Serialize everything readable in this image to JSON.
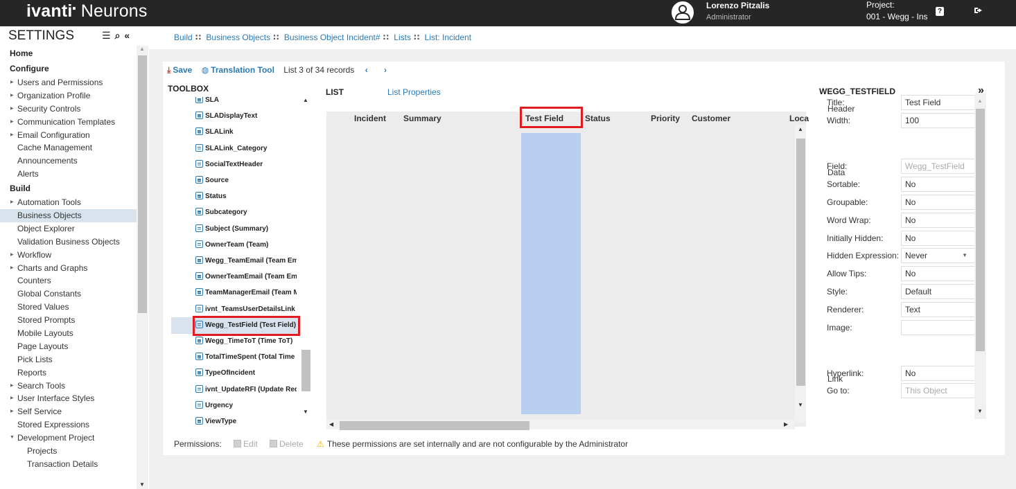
{
  "app": {
    "brand_bold": "ivanti",
    "brand_light": "Neurons"
  },
  "user": {
    "name": "Lorenzo Pitzalis",
    "role": "Administrator"
  },
  "project": {
    "label": "Project:",
    "value": "001 - Wegg - Ins"
  },
  "sidebar": {
    "title": "SETTINGS",
    "items": [
      {
        "label": "Home",
        "type": "section"
      },
      {
        "label": "Configure",
        "type": "section"
      },
      {
        "label": "Users and Permissions",
        "type": "arrow"
      },
      {
        "label": "Organization Profile",
        "type": "arrow"
      },
      {
        "label": "Security Controls",
        "type": "arrow"
      },
      {
        "label": "Communication Templates",
        "type": "arrow"
      },
      {
        "label": "Email Configuration",
        "type": "arrow"
      },
      {
        "label": "Cache Management",
        "type": "plain"
      },
      {
        "label": "Announcements",
        "type": "plain"
      },
      {
        "label": "Alerts",
        "type": "plain"
      },
      {
        "label": "Build",
        "type": "section"
      },
      {
        "label": "Automation Tools",
        "type": "arrow"
      },
      {
        "label": "Business Objects",
        "type": "selected"
      },
      {
        "label": "Object Explorer",
        "type": "plain"
      },
      {
        "label": "Validation Business Objects",
        "type": "plain"
      },
      {
        "label": "Workflow",
        "type": "arrow"
      },
      {
        "label": "Charts and Graphs",
        "type": "arrow"
      },
      {
        "label": "Counters",
        "type": "plain"
      },
      {
        "label": "Global Constants",
        "type": "plain"
      },
      {
        "label": "Stored Values",
        "type": "plain"
      },
      {
        "label": "Stored Prompts",
        "type": "plain"
      },
      {
        "label": "Mobile Layouts",
        "type": "plain"
      },
      {
        "label": "Page Layouts",
        "type": "plain"
      },
      {
        "label": "Pick Lists",
        "type": "plain"
      },
      {
        "label": "Reports",
        "type": "plain"
      },
      {
        "label": "Search Tools",
        "type": "arrow"
      },
      {
        "label": "User Interface Styles",
        "type": "arrow"
      },
      {
        "label": "Self Service",
        "type": "arrow"
      },
      {
        "label": "Stored Expressions",
        "type": "plain"
      },
      {
        "label": "Development Project",
        "type": "arrow-down"
      },
      {
        "label": "Projects",
        "type": "sub"
      },
      {
        "label": "Transaction Details",
        "type": "sub"
      }
    ]
  },
  "breadcrumb": [
    "Build",
    "Business Objects",
    "Business Object Incident#",
    "Lists",
    "List: Incident"
  ],
  "toolbar": {
    "save_label": "Save",
    "translation_label": "Translation Tool",
    "records_info": "List 3 of 34 records",
    "prev": "‹",
    "next": "›"
  },
  "toolbox": {
    "title": "TOOLBOX",
    "items": [
      "SLA",
      "SLADisplayText",
      "SLALink",
      "SLALink_Category",
      "SocialTextHeader",
      "Source",
      "Status",
      "Subcategory",
      "Subject (Summary)",
      "OwnerTeam (Team)",
      "Wegg_TeamEmail (Team Email)",
      "OwnerTeamEmail (Team Email)",
      "TeamManagerEmail (Team Manager Email)",
      "ivnt_TeamsUserDetailsLink",
      "Wegg_TestField (Test Field)",
      "Wegg_TimeToT (Time ToT)",
      "TotalTimeSpent (Total Time Spent)",
      "TypeOfIncident",
      "ivnt_UpdateRFI (Update Request)",
      "Urgency",
      "ViewType"
    ],
    "selected_index": 14
  },
  "list": {
    "title": "LIST",
    "properties_label": "List Properties",
    "columns": [
      "Incident",
      "Summary",
      "Test Field",
      "Status",
      "Priority",
      "Customer",
      "Loca"
    ]
  },
  "properties": {
    "title": "WEGG_TESTFIELD",
    "header_section": "Header",
    "data_section": "Data",
    "link_section": "Link",
    "fields": [
      {
        "label": "Title:",
        "value": "Test Field"
      },
      {
        "label": "Width:",
        "value": "100"
      },
      {
        "label": "Field:",
        "value": "Wegg_TestField"
      },
      {
        "label": "Sortable:",
        "value": "No"
      },
      {
        "label": "Groupable:",
        "value": "No"
      },
      {
        "label": "Word Wrap:",
        "value": "No"
      },
      {
        "label": "Initially Hidden:",
        "value": "No"
      },
      {
        "label": "Hidden Expression:",
        "value": "Never"
      },
      {
        "label": "Allow Tips:",
        "value": "No"
      },
      {
        "label": "Style:",
        "value": "Default"
      },
      {
        "label": "Renderer:",
        "value": "Text"
      },
      {
        "label": "Image:",
        "value": ""
      },
      {
        "label": "Hyperlink:",
        "value": "No"
      },
      {
        "label": "Go to:",
        "value": "This Object"
      }
    ]
  },
  "permissions": {
    "label": "Permissions:",
    "edit": "Edit",
    "delete": "Delete",
    "note": "These permissions are set internally and are not configurable by the Administrator"
  }
}
